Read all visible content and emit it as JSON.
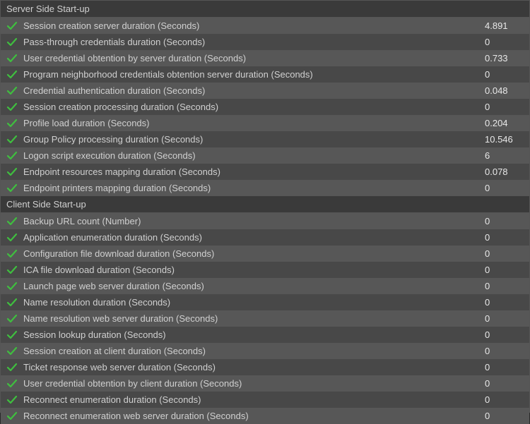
{
  "sections": [
    {
      "title": "Server Side Start-up",
      "rows": [
        {
          "label": "Session creation server duration (Seconds)",
          "value": "4.891"
        },
        {
          "label": "Pass-through credentials duration (Seconds)",
          "value": "0"
        },
        {
          "label": "User credential obtention by server duration (Seconds)",
          "value": "0.733"
        },
        {
          "label": "Program neighborhood credentials obtention server duration (Seconds)",
          "value": "0"
        },
        {
          "label": "Credential authentication duration (Seconds)",
          "value": "0.048"
        },
        {
          "label": "Session creation processing duration (Seconds)",
          "value": "0"
        },
        {
          "label": "Profile load duration (Seconds)",
          "value": "0.204"
        },
        {
          "label": "Group Policy processing duration (Seconds)",
          "value": "10.546"
        },
        {
          "label": "Logon script execution duration (Seconds)",
          "value": "6"
        },
        {
          "label": "Endpoint resources mapping duration (Seconds)",
          "value": "0.078"
        },
        {
          "label": "Endpoint printers mapping duration (Seconds)",
          "value": "0"
        }
      ]
    },
    {
      "title": "Client Side Start-up",
      "rows": [
        {
          "label": "Backup URL count (Number)",
          "value": "0"
        },
        {
          "label": "Application enumeration duration (Seconds)",
          "value": "0"
        },
        {
          "label": "Configuration file download duration (Seconds)",
          "value": "0"
        },
        {
          "label": "ICA file download duration (Seconds)",
          "value": "0"
        },
        {
          "label": "Launch page web server duration (Seconds)",
          "value": "0"
        },
        {
          "label": "Name resolution duration (Seconds)",
          "value": "0"
        },
        {
          "label": "Name resolution web server duration (Seconds)",
          "value": "0"
        },
        {
          "label": "Session lookup duration (Seconds)",
          "value": "0"
        },
        {
          "label": "Session creation at client duration (Seconds)",
          "value": "0"
        },
        {
          "label": "Ticket response web server duration (Seconds)",
          "value": "0"
        },
        {
          "label": "User credential obtention by client duration (Seconds)",
          "value": "0"
        },
        {
          "label": "Reconnect enumeration duration (Seconds)",
          "value": "0"
        },
        {
          "label": "Reconnect enumeration web server duration (Seconds)",
          "value": "0"
        }
      ]
    }
  ]
}
